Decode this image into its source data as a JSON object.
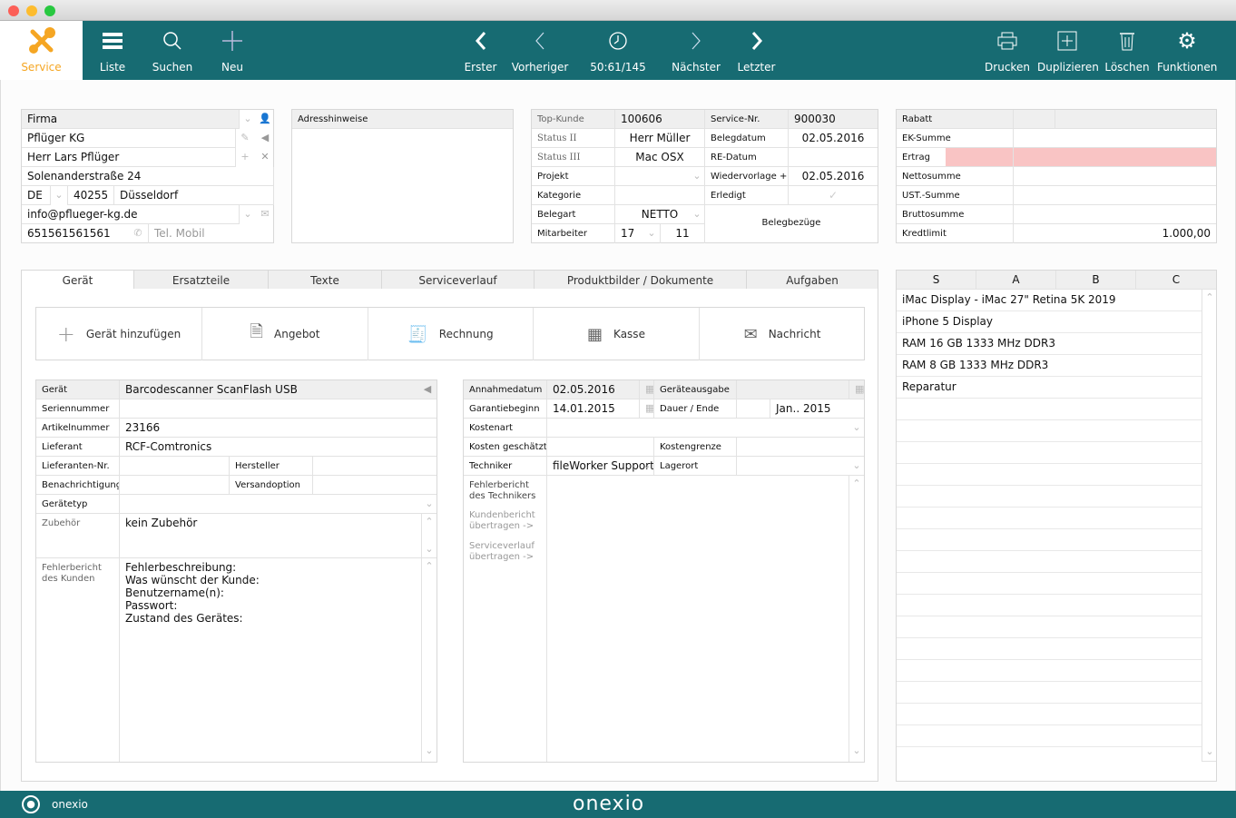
{
  "toolbar": {
    "service": "Service",
    "list": "Liste",
    "search": "Suchen",
    "new": "Neu",
    "first": "Erster",
    "previous": "Vorheriger",
    "record_position": "50:61/145",
    "next": "Nächster",
    "last": "Letzter",
    "print": "Drucken",
    "duplicate": "Duplizieren",
    "delete": "Löschen",
    "functions": "Funktionen"
  },
  "address": {
    "header": "Firma",
    "company": "Pflüger KG",
    "contact": "Herr Lars Pflüger",
    "street": "Solenanderstraße 24",
    "country": "DE",
    "zip": "40255",
    "city": "Düsseldorf",
    "email": "info@pflueger-kg.de",
    "phone": "651561561561",
    "mobile_placeholder": "Tel. Mobil"
  },
  "address_notes": {
    "header": "Adresshinweise",
    "value": ""
  },
  "document": {
    "top_customer_label": "Top-Kunde",
    "top_customer": "100606",
    "service_no_label": "Service-Nr.",
    "service_no": "900030",
    "status2_label": "Status II",
    "status2": "Herr Müller",
    "doc_date_label": "Belegdatum",
    "doc_date": "02.05.2016",
    "status3_label": "Status III",
    "status3": "Mac OSX",
    "invoice_date_label": "RE-Datum",
    "invoice_date": "",
    "project_label": "Projekt",
    "project": "",
    "resubmission_label": "Wiedervorlage +",
    "resubmission": "02.05.2016",
    "category_label": "Kategorie",
    "category": "",
    "done_label": "Erledigt",
    "doc_type_label": "Belegart",
    "doc_type": "NETTO",
    "references_label": "Belegbezüge",
    "employee_label": "Mitarbeiter",
    "employee": "17",
    "employee2": "11"
  },
  "totals": {
    "discount_label": "Rabatt",
    "purchase_label": "EK-Summe",
    "profit_label": "Ertrag",
    "net_label": "Nettosumme",
    "vat_label": "UST.-Summe",
    "gross_label": "Bruttosumme",
    "credit_label": "Kredtlimit",
    "credit": "1.000,00",
    "profit_color": "#f9c4c4"
  },
  "tabs": [
    "Gerät",
    "Ersatzteile",
    "Texte",
    "Serviceverlauf",
    "Produktbilder / Dokumente",
    "Aufgaben"
  ],
  "actions": [
    "Gerät hinzufügen",
    "Angebot",
    "Rechnung",
    "Kasse",
    "Nachricht"
  ],
  "device": {
    "device_label": "Gerät",
    "device": "Barcodescanner ScanFlash USB",
    "serial_label": "Seriennummer",
    "serial": "",
    "article_label": "Artikelnummer",
    "article": "23166",
    "supplier_label": "Lieferant",
    "supplier": "RCF-Comtronics",
    "supplier_no_label": "Lieferanten-Nr.",
    "manufacturer_label": "Hersteller",
    "notification_label": "Benachrichtigung",
    "shipping_label": "Versandoption",
    "type_label": "Gerätetyp",
    "accessories_label": "Zubehör",
    "accessories": "kein Zubehör",
    "customer_report_label_1": "Fehlerbericht",
    "customer_report_label_2": "des Kunden",
    "customer_report": [
      "Fehlerbeschreibung:",
      "Was wünscht der Kunde:",
      "Benutzername(n):",
      "Passwort:",
      "Zustand des Gerätes:"
    ]
  },
  "service": {
    "received_label": "Annahmedatum",
    "received": "02.05.2016",
    "returned_label": "Geräteausgabe",
    "warranty_label": "Garantiebeginn",
    "warranty": "14.01.2015",
    "duration_label": "Dauer / Ende",
    "warranty_end": "Jan.. 2015",
    "cost_type_label": "Kostenart",
    "cost_est_label": "Kosten geschätzt",
    "cost_limit_label": "Kostengrenze",
    "technician_label": "Techniker",
    "technician": "fileWorker Support",
    "storage_label": "Lagerort",
    "tech_report_label_1": "Fehlerbericht",
    "tech_report_label_2": "des Technikers",
    "copy_customer_1": "Kundenbericht",
    "copy_customer_2": "übertragen ->",
    "copy_history_1": "Serviceverlauf",
    "copy_history_2": "übertragen ->"
  },
  "parts_list": {
    "columns": [
      "S",
      "A",
      "B",
      "C"
    ],
    "rows": [
      "iMac Display - iMac 27\" Retina 5K 2019",
      "iPhone 5 Display",
      "RAM 16 GB 1333 MHz DDR3",
      "RAM 8 GB 1333 MHz DDR3",
      "Reparatur"
    ]
  },
  "footer": {
    "user": "onexio",
    "logo": "onexio"
  },
  "colors": {
    "brand": "#176b72",
    "accent": "#f5a623"
  }
}
